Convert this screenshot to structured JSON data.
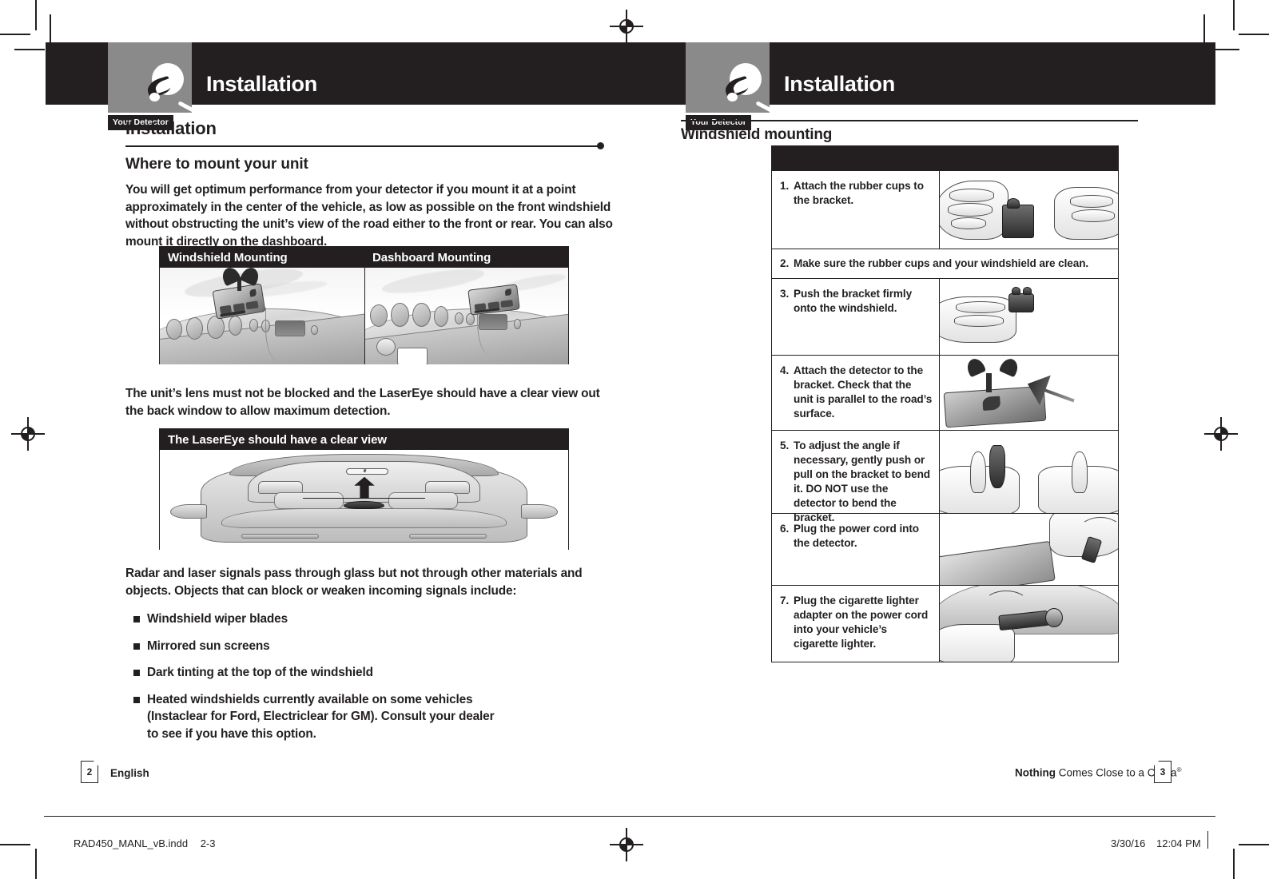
{
  "left_page": {
    "running_head": "Installation",
    "logo_label": "Your Detector",
    "section_title": "Installation",
    "sub_title": "Where to mount your unit",
    "intro": "You will get optimum performance from your detector if you mount it at a point approximately in the center of the vehicle, as low as possible on the front windshield without obstructing the unit’s view of the road either to the front or rear. You can also mount it directly on the dashboard.",
    "fig1": {
      "caption_left": "Windshield Mounting",
      "caption_right": "Dashboard Mounting"
    },
    "mid_text": "The unit’s lens must not be blocked and the LaserEye should have a clear view out the back window to allow maximum detection.",
    "fig2": {
      "caption": "The LaserEye should have a clear view"
    },
    "bullets_intro": "Radar and laser signals pass through glass but not through other materials and objects. Objects that can block or weaken incoming signals include:",
    "bullets": [
      "Windshield wiper blades",
      "Mirrored sun screens",
      "Dark tinting at the top of the windshield",
      "Heated windshields currently available on some vehicles (Instaclear for Ford, Electriclear for GM). Consult your dealer to see if you have this option."
    ],
    "footer": {
      "page_number": "2",
      "language": "English"
    }
  },
  "right_page": {
    "running_head": "Installation",
    "logo_label": "Your Detector",
    "section_title": "Windshield mounting",
    "steps": [
      {
        "num": "1.",
        "text": "Attach the rubber cups to the bracket.",
        "has_image": true,
        "full_width": false
      },
      {
        "num": "2.",
        "text": "Make sure the rubber cups and your windshield are clean.",
        "has_image": false,
        "full_width": true
      },
      {
        "num": "3.",
        "text": "Push the bracket firmly onto the windshield.",
        "has_image": true,
        "full_width": false
      },
      {
        "num": "4.",
        "text": "Attach the detector to the bracket. ",
        "bold_tail": "Check that the unit is parallel to the road’s surface.",
        "has_image": true,
        "full_width": false
      },
      {
        "num": "5.",
        "text": "To adjust the angle if necessary, gently push or pull on the bracket to bend it. DO NOT use the detector to bend the bracket.",
        "has_image": true,
        "full_width": false
      },
      {
        "num": "6.",
        "text": "Plug the power cord into the detector.",
        "has_image": true,
        "full_width": false
      },
      {
        "num": "7.",
        "text": "Plug the cigarette lighter adapter on the power cord into your vehicle’s cigarette lighter.",
        "has_image": true,
        "full_width": false
      }
    ],
    "footer": {
      "page_number": "3",
      "tagline_bold": "Nothing",
      "tagline_rest": " Comes Close to a Cobra",
      "tagline_mark": "®"
    }
  },
  "print_bar": {
    "filename": "RAD450_MANL_vB.indd",
    "spread": "2-3",
    "date": "3/30/16",
    "time": "12:04 PM"
  },
  "colors": {
    "ink": "#231f20",
    "logo_panel": "#8a8a8a",
    "paper": "#ffffff"
  }
}
